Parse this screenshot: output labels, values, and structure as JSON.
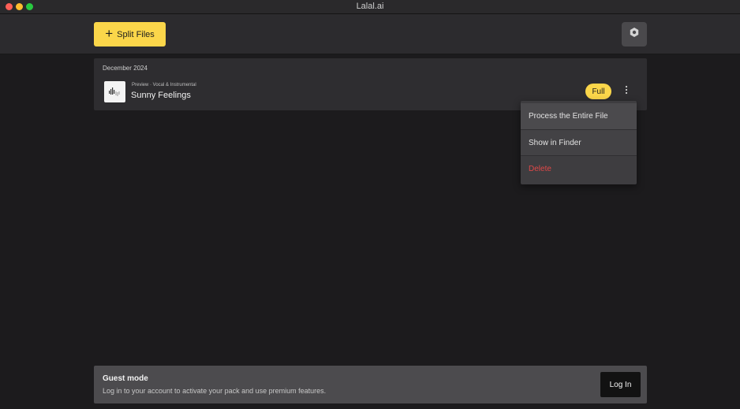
{
  "window": {
    "title": "Lalal.ai"
  },
  "toolbar": {
    "split_files_label": "Split Files",
    "settings_icon": "settings-icon"
  },
  "files": {
    "group_date": "December 2024",
    "items": [
      {
        "meta": "Preview · Vocal & Instrumental",
        "name": "Sunny Feelings",
        "badge": "Full"
      }
    ]
  },
  "context_menu": {
    "items": [
      {
        "label": "Process the Entire File"
      },
      {
        "label": "Show in Finder"
      },
      {
        "label": "Delete",
        "color": "#e04848"
      }
    ]
  },
  "guest_banner": {
    "title": "Guest mode",
    "description": "Log in to your account to activate your pack and use premium features.",
    "login_label": "Log In"
  },
  "colors": {
    "accent": "#fbd64a",
    "background": "#1c1b1d",
    "danger": "#e04848"
  }
}
